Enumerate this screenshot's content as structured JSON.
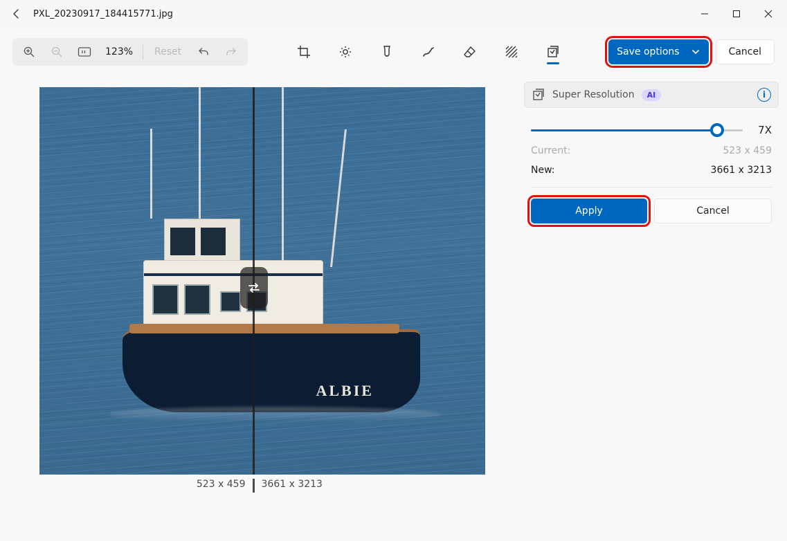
{
  "titlebar": {
    "filename": "PXL_20230917_184415771.jpg"
  },
  "zoom": {
    "percent": "123%",
    "reset_label": "Reset"
  },
  "tools": {
    "names": [
      "crop",
      "adjust",
      "markup",
      "draw",
      "erase",
      "background",
      "super-resolution"
    ]
  },
  "save_options_label": "Save options",
  "top_cancel_label": "Cancel",
  "comparator": {
    "left_dim": "523 x 459",
    "right_dim": "3661 x 3213",
    "boat_name": "ALBIE"
  },
  "panel": {
    "title": "Super Resolution",
    "ai_badge": "AI",
    "multiplier": "7X",
    "current_label": "Current:",
    "current_value": "523 x 459",
    "new_label": "New:",
    "new_value": "3661 x 3213",
    "apply_label": "Apply",
    "cancel_label": "Cancel"
  }
}
